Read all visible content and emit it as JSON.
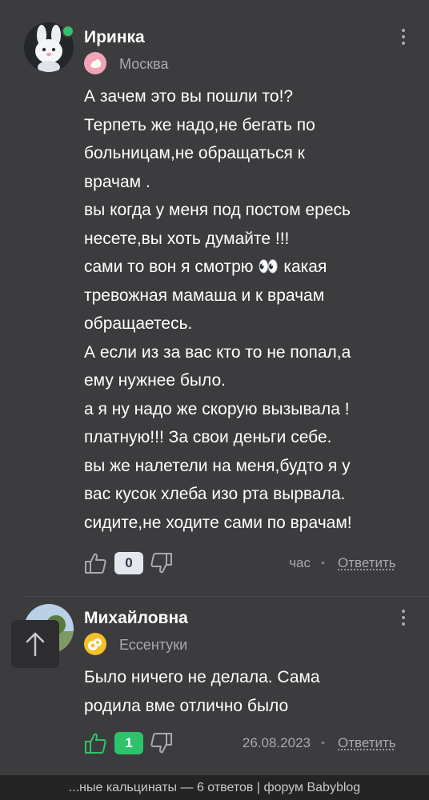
{
  "comments": [
    {
      "author": "Иринка",
      "city": "Москва",
      "lines": [
        "А зачем это вы пошли то!?",
        "Терпеть же надо,не бегать по",
        "больницам,не обращаться к",
        "врачам .",
        "вы когда у меня под постом ересь",
        "несете,вы хоть думайте !!!",
        "сами то вон я смотрю 👀 какая",
        "тревожная мамаша и к врачам",
        "обращаетесь.",
        "А если из за вас кто то не попал,а",
        "ему нужнее было.",
        "а я ну надо же скорую вызывала !",
        "платную!!! За свои деньги себе.",
        "вы же налетели на меня,будто я у",
        "вас кусок хлеба изо рта вырвала.",
        "сидите,не ходите сами по врачам!"
      ],
      "score": "0",
      "time": "час",
      "reply_label": "Ответить",
      "online": true,
      "colors": {
        "score_bg": "#e4e8ee",
        "score_fg": "#2f3a4a",
        "vote_icon": "#a9a9ad"
      }
    },
    {
      "author": "Михайловна",
      "city": "Ессентуки",
      "lines": [
        "Было ничего не делала. Сама",
        "родила вме отлично было"
      ],
      "score": "1",
      "time": "26.08.2023",
      "reply_label": "Ответить",
      "online": false,
      "colors": {
        "score_bg": "#2dc36a",
        "score_fg": "#ffffff",
        "vote_icon": "#2dc36a"
      }
    }
  ],
  "scroll_top_icon": "arrow-up-icon",
  "footer_text": "...ные кальцинаты — 6 ответов | форум Babyblog",
  "colors": {
    "background": "#3c3c3e",
    "online": "#34c06a",
    "footer_bg": "#242424"
  }
}
